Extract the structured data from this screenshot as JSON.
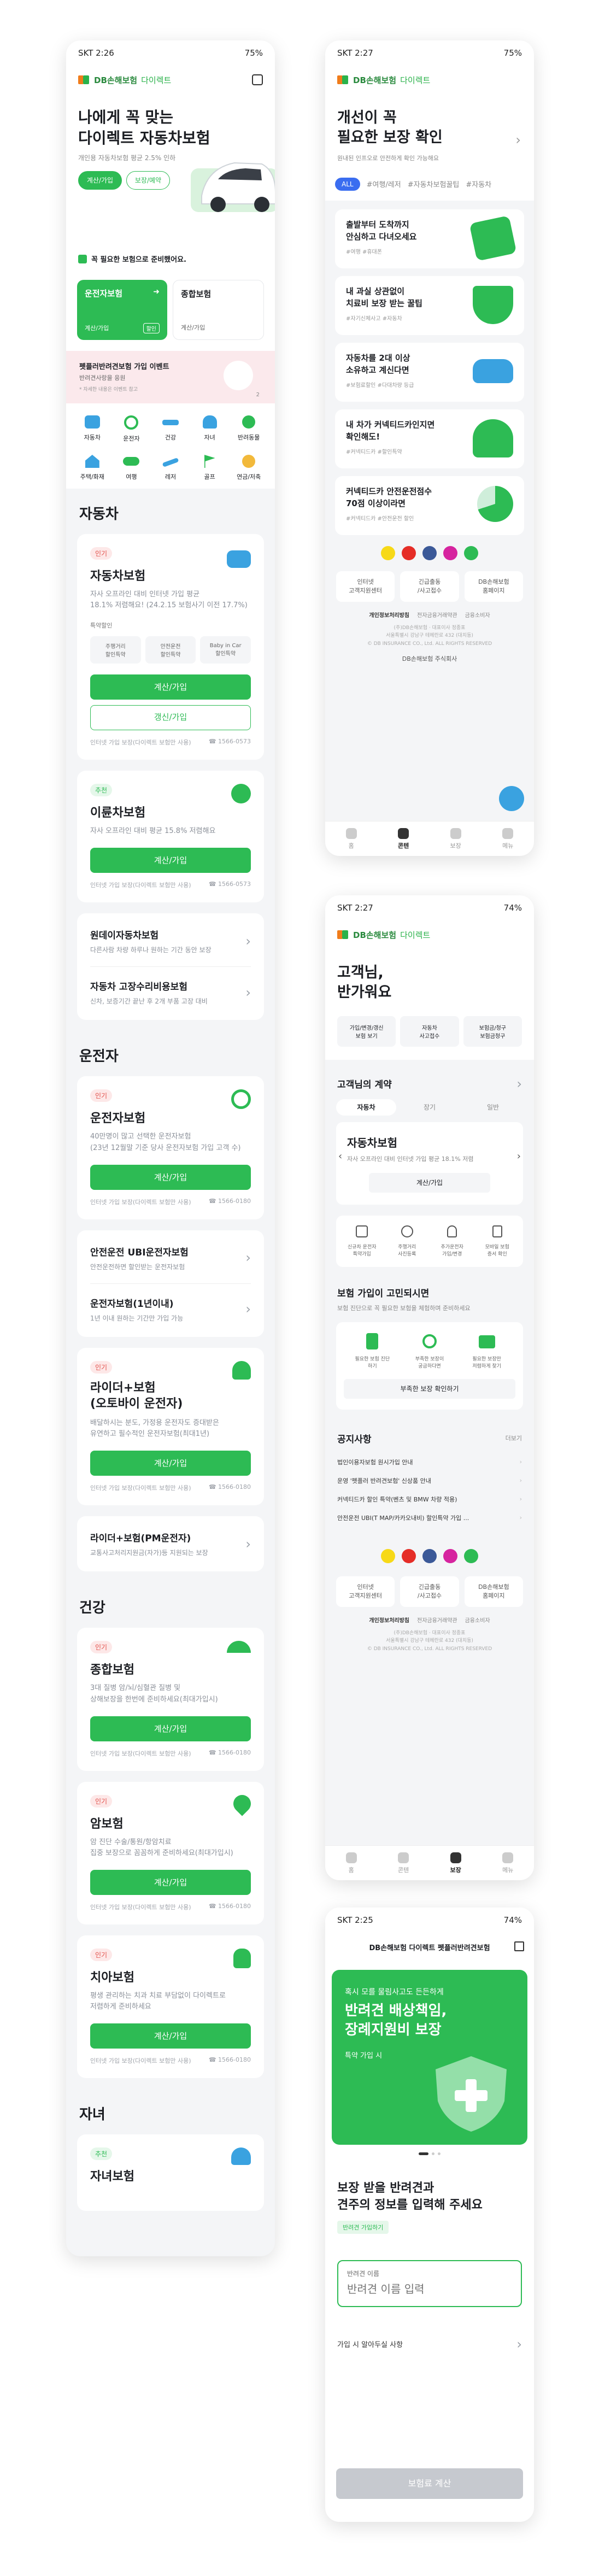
{
  "brand": {
    "logo_text": "DB손해보험",
    "logo_sub": "다이렉트"
  },
  "p1": {
    "status": {
      "time": "SKT 2:26",
      "battery": "75%"
    },
    "hero": {
      "title_line1": "나에게 꼭 맞는",
      "title_line2": "다이렉트 자동차보험",
      "subtitle": "개인용 자동차보험 평균 2.5% 인하",
      "btn_calc": "계산/가입",
      "btn_check": "보장/예약",
      "notice": "꼭 필요한 보험으로 준비했어요."
    },
    "quick": [
      {
        "title": "운전자보험",
        "action": "계산/가입",
        "badge": "할인"
      },
      {
        "title": "종합보험",
        "action": "계산/가입"
      }
    ],
    "banner": {
      "line1": "펫플러반려견보험 가입 이벤트",
      "line2": "반려견사랑을 응원",
      "line3": "* 자세한 내용은 이벤트 참고",
      "page": "2"
    },
    "categories": [
      [
        "자동차",
        "운전자",
        "건강",
        "자녀",
        "반려동물"
      ],
      [
        "주택/화재",
        "여행",
        "레저",
        "골프",
        "연금/저축"
      ]
    ],
    "sec_car": "자동차",
    "car_main": {
      "tag": "인기",
      "name": "자동차보험",
      "desc1": "자사 오프라인 대비 인터넷 가입 평균",
      "desc2": "18.1% 저렴해요! (24.2.15 보험사기 이전 17.7%)",
      "opts_label": "특약할인",
      "opts": [
        "주행거리\n할인특약",
        "안전운전\n할인특약",
        "Baby in Car\n할인특약"
      ],
      "btn_calc": "계산/가입",
      "btn_renew": "갱신/가입",
      "note_left": "인터넷 가입 보장(다이렉트 보험만 사용)",
      "note_right": "☎ 1566-0573"
    },
    "bike": {
      "tag": "추천",
      "name": "이륜차보험",
      "desc": "자사 오프라인 대비 평균 15.8% 저렴해요",
      "btn": "계산/가입",
      "note_left": "인터넷 가입 보장(다이렉트 보험만 사용)",
      "note_right": "☎ 1566-0573"
    },
    "car_list": [
      {
        "title": "원데이자동차보험",
        "sub": "다른사람 차량 하루나 원하는 기간 동안 보장"
      },
      {
        "title": "자동차 고장수리비용보험",
        "sub": "신차, 보증기간 끝난 후 2개 부품 고장 대비"
      }
    ],
    "sec_driver": "운전자",
    "driver_main": {
      "tag": "인기",
      "name": "운전자보험",
      "desc1": "40만명이 많고 선택한 운전자보험",
      "desc2": "(23년 12월말 기준 당사 운전자보험 가입 고객 수)",
      "btn": "계산/가입",
      "note_left": "인터넷 가입 보장(다이렉트 보험만 사용)",
      "note_right": "☎ 1566-0180"
    },
    "driver_list": [
      {
        "title": "안전운전 UBI운전자보험",
        "sub": "안전운전하면 할인받는 운전자보험"
      },
      {
        "title": "운전자보험(1년이내)",
        "sub": "1년 이내 원하는 기간만 가입 가능"
      }
    ],
    "rider": {
      "tag": "인기",
      "name1": "라이더+보험",
      "name2": "(오토바이 운전자)",
      "desc1": "배달하시는 분도, 가정용 운전자도 증대받은",
      "desc2": "유연하고 필수적인 운전자보험(최대1년)",
      "btn": "계산/가입",
      "note_left": "인터넷 가입 보장(다이렉트 보험만 사용)",
      "note_right": "☎ 1566-0180"
    },
    "pm": {
      "title": "라이더+보험(PM운전자)",
      "sub": "교통사고처리지원금(자가)등 지원되는 보장"
    },
    "sec_health": "건강",
    "health": [
      {
        "tag": "인기",
        "name": "종합보험",
        "desc1": "3대 질병 암/뇌/심혈관 질병 및",
        "desc2": "상해보장을 한번에 준비하세요(최대가입시)",
        "btn": "계산/가입",
        "note_left": "인터넷 가입 보장(다이렉트 보험만 사용)",
        "note_right": "☎ 1566-0180"
      },
      {
        "tag": "인기",
        "name": "암보험",
        "desc1": "암 진단 수술/통원/항암치료",
        "desc2": "집중 보장으로 꼼꼼하게 준비하세요(최대가입시)",
        "btn": "계산/가입",
        "note_left": "인터넷 가입 보장(다이렉트 보험만 사용)",
        "note_right": "☎ 1566-0180"
      },
      {
        "tag": "인기",
        "name": "치아보험",
        "desc1": "평생 관리하는 치과 치료 부담없이 다이렉트로",
        "desc2": "저렴하게 준비하세요",
        "btn": "계산/가입",
        "note_left": "인터넷 가입 보장(다이렉트 보험만 사용)",
        "note_right": "☎ 1566-0180"
      }
    ],
    "sec_child": "자녀",
    "child": {
      "tag": "추천",
      "name": "자녀보험"
    }
  },
  "p2": {
    "status": {
      "time": "SKT 2:27",
      "battery": "75%"
    },
    "title1": "개선이 꼭",
    "title2": "필요한 보장 확인",
    "sub": "원내된 인프오로 안전하게 확인 가능해요",
    "chips": [
      "ALL",
      "#여행/레저",
      "#자동차보험꿀팁",
      "#자동차"
    ],
    "cards": [
      {
        "title": "출발부터 도착까지\n안심하고 다녀오세요",
        "hash": "#여행 #휴대폰"
      },
      {
        "title": "내 과실 상관없이\n치료비 보장 받는 꿀팁",
        "hash": "#자기신체사고 #자동차"
      },
      {
        "title": "자동차를 2대 이상\n소유하고 계신다면",
        "hash": "#보험료할인 #다대차량 등급"
      },
      {
        "title": "내 차가 커넥티드카인지면\n확인해도!",
        "hash": "#커넥티드카 #할인특약"
      },
      {
        "title": "커넥티드카 안전운전점수\n70점 이상이라면",
        "hash": "#커넥티드카 #안전운전 할인"
      }
    ],
    "footer": {
      "boxes": [
        "인터넷\n고객지원센터",
        "긴급출동\n/사고접수",
        "DB손해보험\n홈페이지"
      ],
      "links": [
        "개인정보처리방침",
        "전자금융거래약관",
        "금융소비자"
      ],
      "copy1": "(주)DB손해보험 · 대표이사 정종표",
      "copy2": "서울특별시 강남구 테헤란로 432 (대치동)",
      "copy3": "© DB INSURANCE CO., Ltd. ALL RIGHTS RESERVED",
      "family": "DB손해보험 주식회사"
    },
    "tabs": [
      "홈",
      "콘텐",
      "보장",
      "메뉴"
    ]
  },
  "p3": {
    "status": {
      "time": "SKT 2:27",
      "battery": "74%"
    },
    "greet1": "고객님,",
    "greet2": "반가워요",
    "q_btns": [
      "가입/변경/갱신\n보험 보기",
      "자동차\n사고접수",
      "보험금/청구\n보험금청구"
    ],
    "contracts_title": "고객님의 계약",
    "contract_tabs": [
      "자동차",
      "장기",
      "일반"
    ],
    "contract": {
      "name": "자동차보험",
      "desc": "자사 오프라인 대비 인터넷 가입 평균 18.1% 저렴",
      "btn": "계산/가입"
    },
    "icons4": [
      "신규차 운전자\n특약가입",
      "주행거리\n사진등록",
      "추가운전자\n가입/변경",
      "모바일 보험\n증서 확인"
    ],
    "guide_title": "보험 가입이 고민되시면",
    "guide_sub": "보험 진단으로 꼭 필요한 보험을 체험하며 준비하세요",
    "guide_items": [
      "필요한 보험 진단\n하기",
      "부족한 보장이\n궁금하다면",
      "필요한 보장만\n저렴하게 찾기"
    ],
    "guide_btn": "부족한 보장 확인하기",
    "notice_title": "공지사항",
    "notice_more": "더보기",
    "notices": [
      "법인이용자보험 원시가입 안내",
      "운영 '펫플러 반려견보험' 신상품 안내",
      "커넥티드카 할인 특약(벤츠 및 BMW 차량 적용)",
      "안전운전 UBI(T MAP/카카오내비) 할인특약 가입 ..."
    ],
    "tabs": [
      "홈",
      "콘텐",
      "보장",
      "메뉴"
    ]
  },
  "p4": {
    "status": {
      "time": "SKT 2:25",
      "battery": "74%"
    },
    "header": "DB손해보험 다이렉트 펫플러반려견보험",
    "hero": {
      "line1": "혹시 모를 물림사고도 든든하게",
      "title1": "반려견 배상책임,",
      "title2": "장례지원비 보장",
      "cta": "특약 가입 시"
    },
    "ask1": "보장 받을 반려견과",
    "ask2": "견주의 정보를 입력해 주세요",
    "badge": "반려견 가입하기",
    "input_label": "반려견 이름",
    "input_placeholder": "반려견 이름 입력",
    "notice": "가입 시 알아두실 사항",
    "submit": "보험료 계산"
  }
}
